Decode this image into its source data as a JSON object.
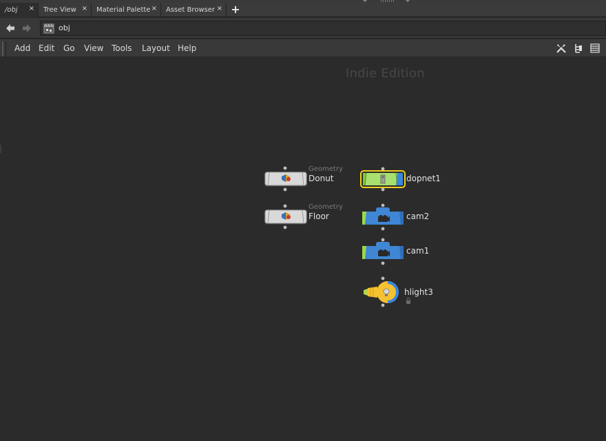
{
  "tabs": [
    {
      "label": "/obj",
      "close": "×",
      "active": true
    },
    {
      "label": "Tree View",
      "close": "×",
      "active": false
    },
    {
      "label": "Material Palette",
      "close": "×",
      "active": false
    },
    {
      "label": "Asset Browser",
      "close": "×",
      "active": false
    }
  ],
  "tab_add": "+",
  "path": {
    "text": "obj"
  },
  "menu": [
    "Add",
    "Edit",
    "Go",
    "View",
    "Tools",
    "Layout",
    "Help"
  ],
  "toolbar_icons": [
    "wrench-icon",
    "tree-icon",
    "list-icon"
  ],
  "canvas": {
    "watermark": "Indie Edition"
  },
  "nodes": [
    {
      "name": "Donut",
      "type": "Geometry",
      "kind": "geometry"
    },
    {
      "name": "Floor",
      "type": "Geometry",
      "kind": "geometry"
    },
    {
      "name": "dopnet1",
      "type": "",
      "kind": "dopnet",
      "selected": true
    },
    {
      "name": "cam2",
      "type": "",
      "kind": "camera"
    },
    {
      "name": "cam1",
      "type": "",
      "kind": "camera"
    },
    {
      "name": "hlight3",
      "type": "",
      "kind": "light"
    }
  ],
  "colors": {
    "background": "#2b2b2b",
    "geometry_node": "#d8d8d8",
    "camera_node": "#3f86d4",
    "dopnet_node": "#a7e06e",
    "light_node": "#f6c232",
    "selection": "#f2d21e",
    "display_flag": "#3a86e0",
    "template_flag": "#9ad94a"
  }
}
